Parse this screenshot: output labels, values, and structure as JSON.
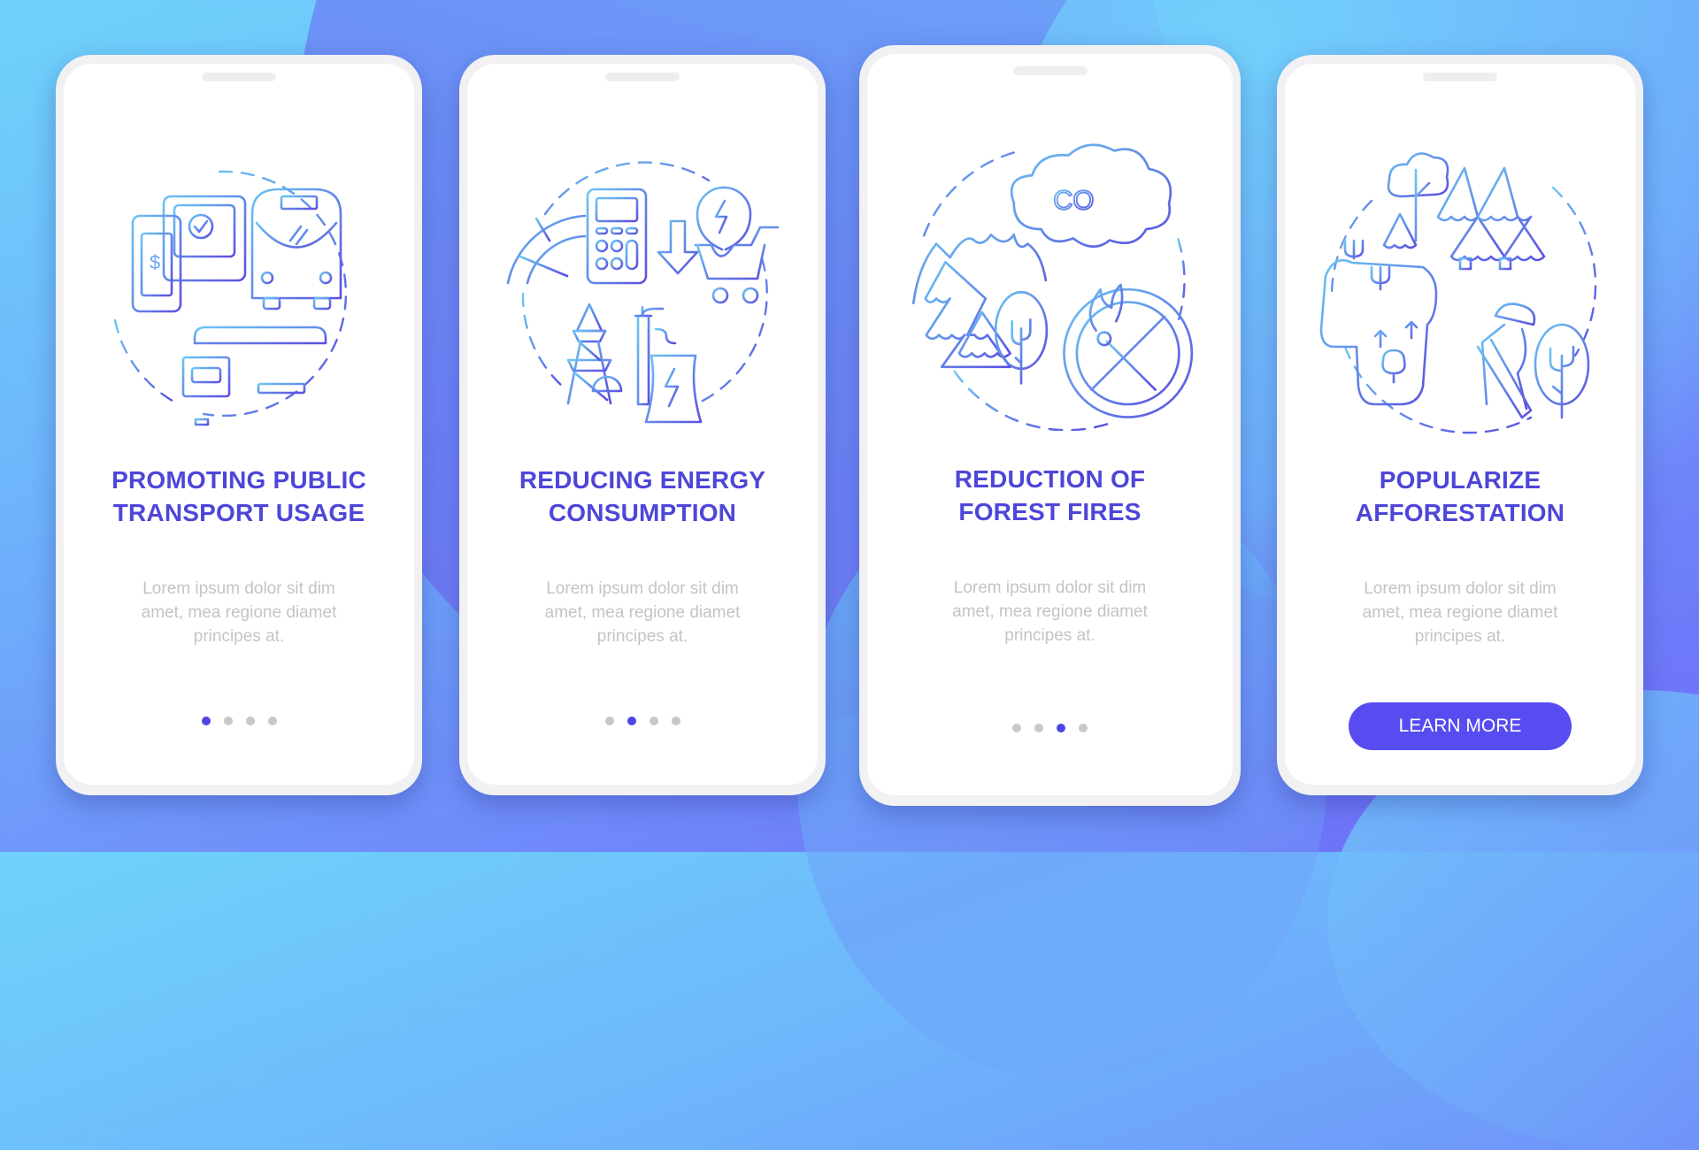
{
  "colors": {
    "accent": "#574cf0",
    "title": "#4e46d8",
    "description": "#c4c4c8",
    "dot_active": "#4f45e4",
    "dot_inactive": "#c8c8cc",
    "icon_gradient_start": "#6cc6f2",
    "icon_gradient_end": "#5b4fe0"
  },
  "screens": [
    {
      "illustration": "public-transport-icon",
      "title_lines": [
        "PROMOTING PUBLIC",
        "TRANSPORT USAGE"
      ],
      "description_lines": [
        "Lorem ipsum dolor sit dim",
        "amet, mea regione diamet",
        "principes at."
      ],
      "page_index": 1,
      "page_count": 4
    },
    {
      "illustration": "energy-consumption-icon",
      "title_lines": [
        "REDUCING ENERGY",
        "CONSUMPTION"
      ],
      "description_lines": [
        "Lorem ipsum dolor sit dim",
        "amet, mea regione diamet",
        "principes at."
      ],
      "page_index": 2,
      "page_count": 4
    },
    {
      "illustration": "forest-fire-prevention-icon",
      "title_lines": [
        "REDUCTION OF",
        "FOREST FIRES"
      ],
      "icon_text": "CO",
      "description_lines": [
        "Lorem ipsum dolor sit dim",
        "amet, mea regione diamet",
        "principes at."
      ],
      "page_index": 3,
      "page_count": 4
    },
    {
      "illustration": "afforestation-icon",
      "title_lines": [
        "POPULARIZE",
        "AFFORESTATION"
      ],
      "description_lines": [
        "Lorem ipsum dolor sit dim",
        "amet, mea regione diamet",
        "principes at."
      ],
      "button_label": "LEARN MORE"
    }
  ]
}
